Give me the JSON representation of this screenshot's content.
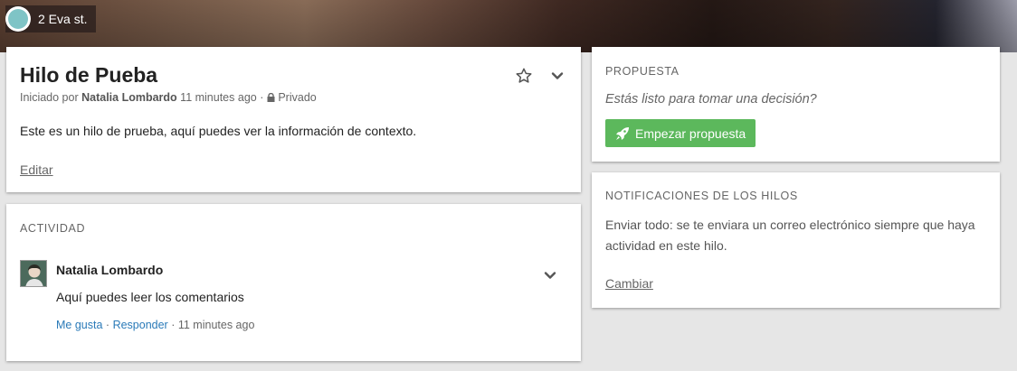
{
  "group": {
    "name": "2 Eva st."
  },
  "thread": {
    "title": "Hilo de Pueba",
    "started_prefix": "Iniciado por",
    "author": "Natalia Lombardo",
    "time": "11 minutes ago",
    "separator": "·",
    "privacy": "Privado",
    "context": "Este es un hilo de prueba, aquí puedes ver la información de contexto.",
    "edit_label": "Editar"
  },
  "activity": {
    "label": "Actividad",
    "items": [
      {
        "author": "Natalia Lombardo",
        "body": "Aquí puedes leer los comentarios",
        "like_label": "Me gusta",
        "reply_label": "Responder",
        "time": "11 minutes ago"
      }
    ]
  },
  "proposal": {
    "label": "Propuesta",
    "question": "Estás listo para tomar una decisión?",
    "button_label": "Empezar propuesta"
  },
  "notifications": {
    "label": "Notificaciones de los hilos",
    "text": "Enviar todo: se te enviara un correo electrónico siempre que haya actividad en este hilo.",
    "change_label": "Cambiar"
  },
  "icons": {
    "star": "star-outline-icon",
    "chevron": "chevron-down-icon",
    "lock": "lock-icon",
    "rocket": "rocket-icon"
  },
  "colors": {
    "primary_button": "#5cb85c",
    "link": "#2a7ab8",
    "group_logo": "#7fc4c6"
  }
}
